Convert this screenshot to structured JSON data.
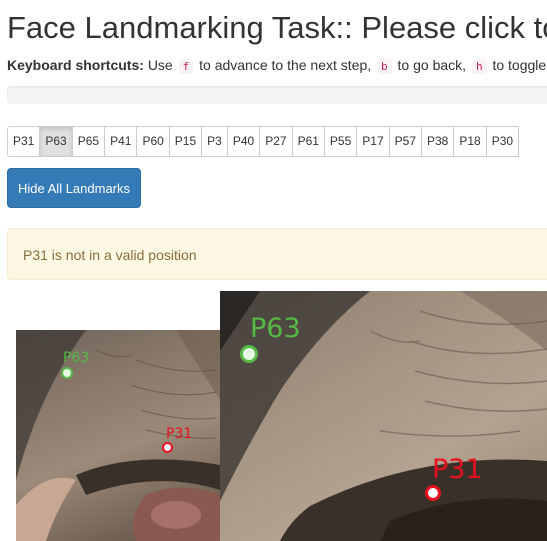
{
  "title": "Face Landmarking Task:: Please click to",
  "shortcuts": {
    "label": "Keyboard shortcuts:",
    "use": "Use",
    "key_f": "f",
    "text_f": "to advance to the next step,",
    "key_b": "b",
    "text_b": "to go back,",
    "key_h": "h",
    "text_h": "to toggle"
  },
  "landmark_buttons": [
    "P31",
    "P63",
    "P65",
    "P41",
    "P60",
    "P15",
    "P3",
    "P40",
    "P27",
    "P61",
    "P55",
    "P17",
    "P57",
    "P38",
    "P18",
    "P30"
  ],
  "active_landmark": "P63",
  "hide_button_label": "Hide All Landmarks",
  "alert_text": "P31 is not in a valid position",
  "points": {
    "green_label": "P63",
    "red_label": "P31",
    "green_color": "#56b946",
    "red_color": "#e8101e"
  },
  "colors": {
    "primary": "#337ab7",
    "alert_bg": "#fcf8e3",
    "alert_text": "#8a6d3b"
  }
}
